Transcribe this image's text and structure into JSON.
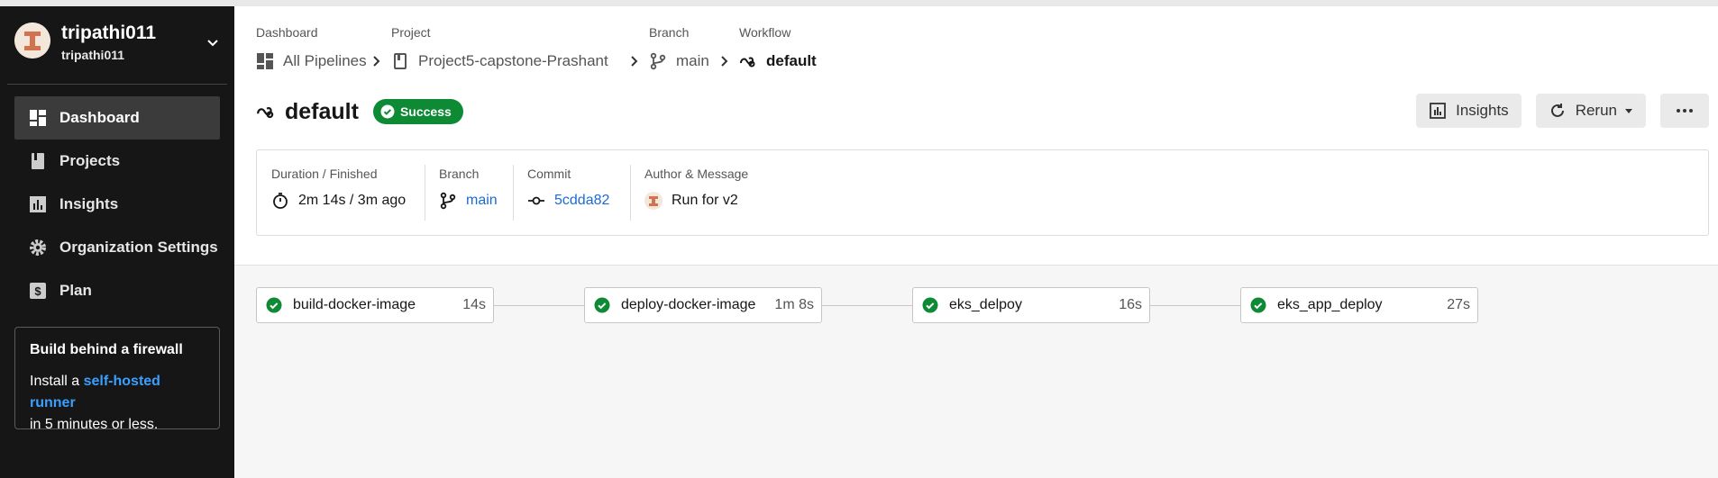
{
  "org": {
    "name": "tripathi011",
    "sub": "tripathi011"
  },
  "nav": [
    {
      "label": "Dashboard",
      "icon": "dashboard-icon",
      "active": true
    },
    {
      "label": "Projects",
      "icon": "projects-icon",
      "active": false
    },
    {
      "label": "Insights",
      "icon": "insights-icon",
      "active": false
    },
    {
      "label": "Organization Settings",
      "icon": "gear-icon",
      "active": false
    },
    {
      "label": "Plan",
      "icon": "dollar-icon",
      "active": false
    }
  ],
  "promo": {
    "title": "Build behind a firewall",
    "pre": "Install a ",
    "link": "self-hosted runner",
    "post": "in 5 minutes or less."
  },
  "breadcrumb": [
    {
      "header": "Dashboard",
      "value": "All Pipelines"
    },
    {
      "header": "Project",
      "value": "Project5-capstone-Prashant"
    },
    {
      "header": "Branch",
      "value": "main"
    },
    {
      "header": "Workflow",
      "value": "default"
    }
  ],
  "workflow": {
    "title": "default",
    "status": "Success",
    "status_color": "#0e8a35"
  },
  "actions": {
    "insights": "Insights",
    "rerun": "Rerun"
  },
  "summary": {
    "duration": {
      "header": "Duration / Finished",
      "value": "2m 14s / 3m ago"
    },
    "branch": {
      "header": "Branch",
      "value": "main"
    },
    "commit": {
      "header": "Commit",
      "value": "5cdda82"
    },
    "author": {
      "header": "Author & Message",
      "value": "Run for v2"
    }
  },
  "jobs": [
    {
      "name": "build-docker-image",
      "time": "14s"
    },
    {
      "name": "deploy-docker-image",
      "time": "1m 8s"
    },
    {
      "name": "eks_delpoy",
      "time": "16s"
    },
    {
      "name": "eks_app_deploy",
      "time": "27s"
    }
  ],
  "colors": {
    "sidebar": "#161616",
    "success": "#0e8a35",
    "link": "#1b6bd2"
  }
}
